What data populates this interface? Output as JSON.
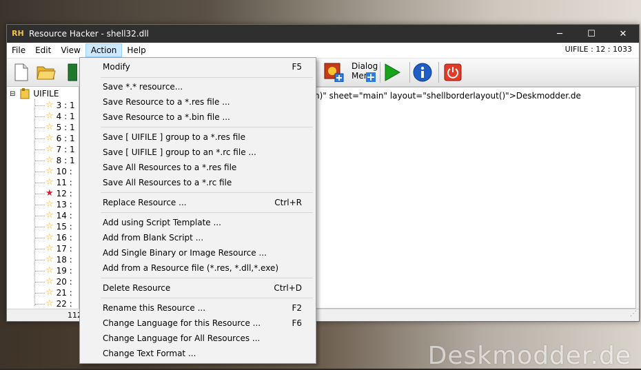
{
  "window": {
    "title": "Resource Hacker - shell32.dll",
    "app_icon_text": "RH",
    "controls": {
      "minimize": "─",
      "maximize": "☐",
      "close": "✕"
    }
  },
  "menubar": {
    "items": [
      "File",
      "Edit",
      "View",
      "Action",
      "Help"
    ],
    "active": "Action",
    "resource_id": "UIFILE : 12 : 1033"
  },
  "toolbar": {
    "dialog_label_line1": "Dialog",
    "dialog_label_line2": "Mer"
  },
  "tree": {
    "root": "UIFILE",
    "items": [
      "3 : 1",
      "4 : 1",
      "5 : 1",
      "6 : 1",
      "7 : 1",
      "8 : 1",
      "10 :",
      "11 :",
      "12 :",
      "13 :",
      "14 :",
      "15 :",
      "16 :",
      "17 :",
      "18 :",
      "19 :",
      "20 :",
      "21 :",
      "22 :"
    ],
    "selected": "12 :"
  },
  "editor": {
    "visible_text": "n)\" sheet=\"main\" layout=\"shellborderlayout()\">Deskmodder.de"
  },
  "status": {
    "count": "112"
  },
  "action_menu": {
    "items": [
      {
        "label": "Modify",
        "shortcut": "F5"
      },
      {
        "label": "Save *.* resource..."
      },
      {
        "label": "Save Resource to a *.res file ..."
      },
      {
        "label": "Save Resource to a *.bin file ..."
      },
      {
        "label": "Save [ UIFILE ] group to a *.res file"
      },
      {
        "label": "Save [ UIFILE ] group to an *.rc file ..."
      },
      {
        "label": "Save All Resources to a *.res file"
      },
      {
        "label": "Save All Resources to a *.rc file"
      },
      {
        "label": "Replace Resource ...",
        "shortcut": "Ctrl+R"
      },
      {
        "label": "Add using Script Template ..."
      },
      {
        "label": "Add from Blank Script ..."
      },
      {
        "label": "Add Single Binary or Image Resource ..."
      },
      {
        "label": "Add from a Resource file (*.res, *.dll,*.exe)"
      },
      {
        "label": "Delete Resource",
        "shortcut": "Ctrl+D"
      },
      {
        "label": "Rename this Resource ...",
        "shortcut": "F2"
      },
      {
        "label": "Change Language for this Resource ...",
        "shortcut": "F6"
      },
      {
        "label": "Change Language for All Resources ..."
      },
      {
        "label": "Change Text Format ..."
      }
    ]
  },
  "watermark": "Deskmodder.de",
  "colors": {
    "titlebar": "#2f2f2f",
    "menu_highlight": "#cce8ff",
    "selected_star": "#d21f3c",
    "star": "#e6b800"
  }
}
